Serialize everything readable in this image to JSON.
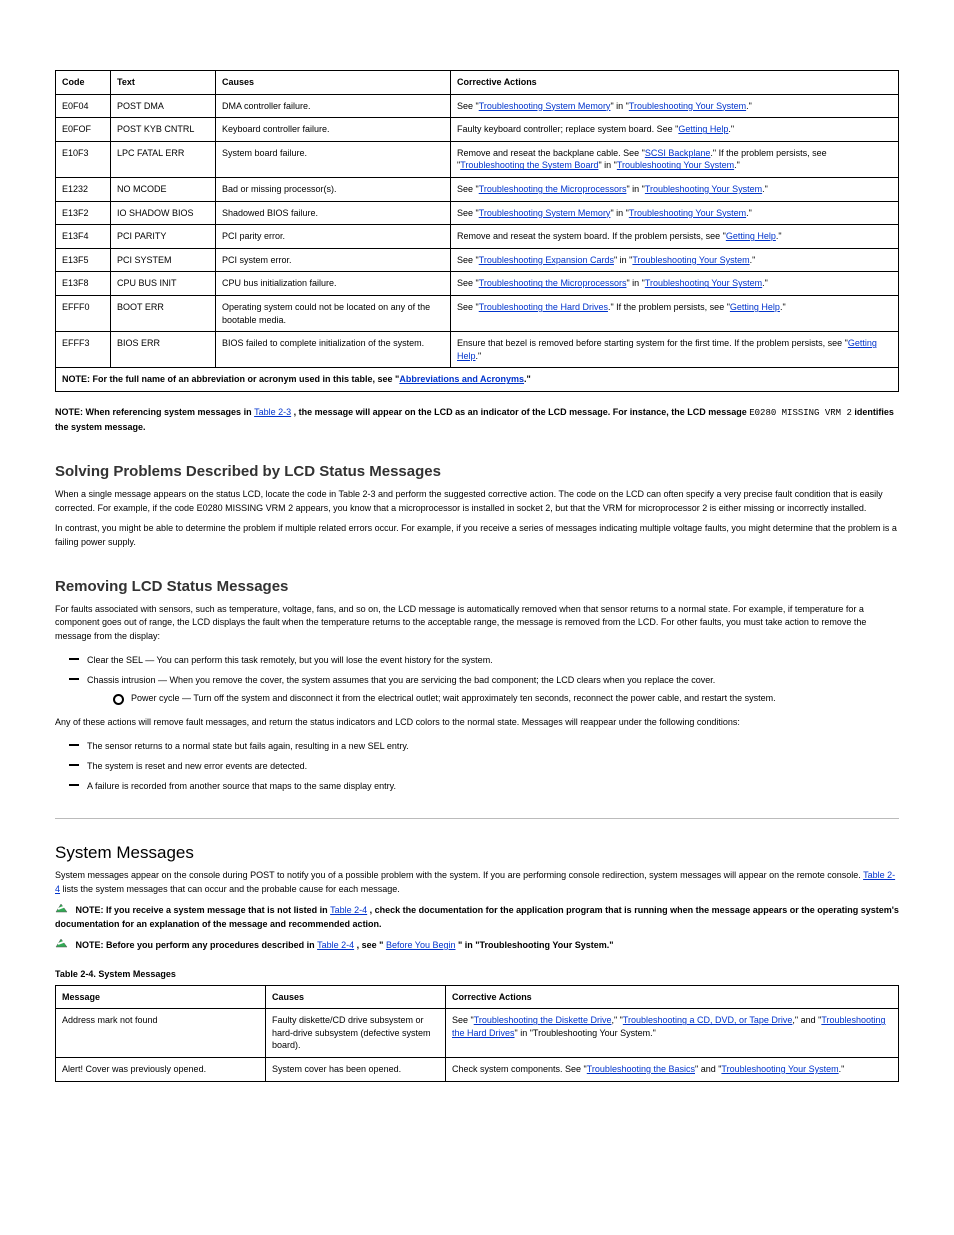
{
  "table1_header": {
    "code": "Code",
    "text": "Text",
    "causes": "Causes",
    "actions": "Corrective Actions"
  },
  "table1_rows": [
    {
      "code": "E0F04",
      "text": "POST DMA",
      "causes": "DMA controller failure.",
      "actions_prefix": "See \"",
      "link1": "Troubleshooting System Memory",
      "mid": "\" in \"",
      "link2": "Troubleshooting Your System",
      "suffix": ".\""
    },
    {
      "code": "E0FOF",
      "text": "POST KYB CNTRL",
      "causes": "Keyboard controller failure.",
      "action_pre": "Faulty keyboard controller; replace system board. See \"",
      "link1": "Getting Help",
      "action_post": ".\""
    },
    {
      "code2lines": true,
      "code": "E10F3",
      "text": "LPC FATAL ERR",
      "causes": "System board failure.",
      "action_pre": "Remove and reseat the backplane cable. See \"",
      "link1": "SCSI Backplane",
      "action_mid1": ".\" If the problem persists, see \"",
      "link2": "Troubleshooting the System Board",
      "action_mid2": "\" in \"",
      "link3": "Troubleshooting Your System",
      "action_post": ".\""
    },
    {
      "code": "E1232",
      "text": "NO MCODE",
      "causes": "Bad or missing processor(s).",
      "action_pre": "See \"",
      "link1": "Troubleshooting the Microprocessors",
      "action_mid": "\" in \"",
      "link2": "Troubleshooting Your System",
      "action_post": ".\""
    },
    {
      "code": "E13F2",
      "text": "IO SHADOW BIOS",
      "causes": "Shadowed BIOS failure.",
      "action_pre": "See \"",
      "link1": "Troubleshooting System Memory",
      "action_mid": "\" in \"",
      "link2": "Troubleshooting Your System",
      "action_post": ".\""
    },
    {
      "code": "E13F4",
      "text": "PCI PARITY",
      "causes": "PCI parity error.",
      "action_pre": "Remove and reseat the system board. If the problem persists, see \"",
      "link1": "Getting Help",
      "action_post": ".\""
    },
    {
      "code": "E13F5",
      "text": "PCI SYSTEM",
      "causes": "PCI system error.",
      "action_pre": "See \"",
      "link1": "Troubleshooting Expansion Cards",
      "action_mid": "\" in \"",
      "link2": "Troubleshooting Your System",
      "action_post": ".\""
    },
    {
      "code": "E13F8",
      "text": "CPU BUS INIT",
      "causes": "CPU bus initialization failure.",
      "action_pre": "See \"",
      "link1": "Troubleshooting the Microprocessors",
      "action_mid": "\" in \"",
      "link2": "Troubleshooting Your System",
      "action_post": ".\""
    },
    {
      "code": "EFFF0",
      "text": "BOOT ERR",
      "causes": "Operating system could not be located on any of the bootable media.",
      "action_pre": "See \"",
      "link1": "Troubleshooting the Hard Drives",
      "action_mid": ".\" If the problem persists, see \"",
      "link2": "Getting Help",
      "action_post": ".\""
    },
    {
      "code": "EFFF3",
      "text": "BIOS ERR",
      "causes": "BIOS failed to complete initialization of the system.",
      "action_pre": "Ensure that bezel is removed before starting system for the first time. If the problem persists, see \"",
      "link1": "Getting Help",
      "action_post": ".\""
    }
  ],
  "table1_footer": {
    "pre": "NOTE: For the full name of an abbreviation or acronym used in this table, see \"",
    "link": "Abbreviations and Acronyms",
    "post": ".\""
  },
  "note_para": {
    "pre": "NOTE: When referencing system messages in ",
    "link": "Table 2-3",
    "mid": ", the message will appear on the LCD as an indicator of the LCD message. For instance, the LCD message ",
    "mono": "E0280  MISSING VRM 2",
    "tail": " identifies the system message."
  },
  "solving_title": "Solving Problems Described by LCD Status Messages",
  "solving_para": "When a single message appears on the status LCD, locate the code in Table 2-3 and perform the suggested corrective action. The code on the LCD can often specify a very precise fault condition that is easily corrected. For example, if the code E0280 MISSING VRM 2 appears, you know that a microprocessor is installed in socket 2, but that the VRM for microprocessor 2 is either missing or incorrectly installed.",
  "solving_para2": "In contrast, you might be able to determine the problem if multiple related errors occur. For example, if you receive a series of messages indicating multiple voltage faults, you might determine that the problem is a failing power supply.",
  "removing_title": "Removing LCD Status Messages",
  "removing_para_pre": "For faults associated with sensors, such as temperature, voltage, fans, and so on, the LCD message is automatically removed when that sensor returns to a normal state. For example, if temperature for a component goes out of range, the LCD displays the fault when the temperature returns to the acceptable range, the message is removed from the LCD. For other faults, you must take action to remove the message from the display:",
  "removing_bullets": [
    "Clear the SEL — You can perform this task remotely, but you will lose the event history for the system.",
    "Chassis intrusion — When you remove the cover, the system assumes that you are servicing the bad component; the LCD clears when you replace the cover."
  ],
  "removing_sub": [
    "Power cycle — Turn off the system and disconnect it from the electrical outlet; wait approximately ten seconds, reconnect the power cable, and restart the system."
  ],
  "removing_tail": "Any of these actions will remove fault messages, and return the status indicators and LCD colors to the normal state. Messages will reappear under the following conditions:",
  "reappear_bullets": [
    "The sensor returns to a normal state but fails again, resulting in a new SEL entry.",
    "The system is reset and new error events are detected.",
    "A failure is recorded from another source that maps to the same display entry."
  ],
  "hr_section": "System Messages",
  "sysmsg_para_pre": "System messages appear on the console during POST to notify you of a possible problem with the system. If you are performing console redirection, system messages will appear on the remote console. ",
  "sysmsg_link": "Table 2-4",
  "sysmsg_para_post": " lists the system messages that can occur and the probable cause for each message.",
  "note1_pre": "NOTE: If you receive a system message that is not listed in ",
  "note1_link": "Table 2-4",
  "note1_post": ", check the documentation for the application program that is running when the message appears or the operating system's documentation for an explanation of the message and recommended action.",
  "note2_pre": "NOTE: Before you perform any procedures described in ",
  "note2_link": "Table 2-4",
  "note2_mid": ", see \"",
  "note2_link2": "Before You Begin",
  "note2_post": "\" in \"Troubleshooting Your System.\"",
  "caption2": "Table 2-4. System Messages",
  "status_header": {
    "msg": "Message",
    "causes": "Causes",
    "actions": "Corrective Actions"
  },
  "status_rows": [
    {
      "msg": "Address mark not found",
      "causes": "Faulty diskette/CD drive subsystem or hard-drive subsystem (defective system board).",
      "action_pre": "See \"",
      "link1": "Troubleshooting the Diskette Drive",
      "action_mid1": ",\" \"",
      "link2": "Troubleshooting a CD, DVD, or Tape Drive",
      "action_mid2": ",\" and \"",
      "link3": "Troubleshooting the Hard Drives",
      "action_post": "\" in \"Troubleshooting Your System.\""
    },
    {
      "msg": "Alert! Cover was previously opened.",
      "causes": "System cover has been opened.",
      "action_pre": "Check system components. See \"",
      "link1": "Troubleshooting the Basics",
      "action_mid": "\" and \"",
      "link2": "Troubleshooting Your System",
      "action_post": ".\""
    }
  ]
}
